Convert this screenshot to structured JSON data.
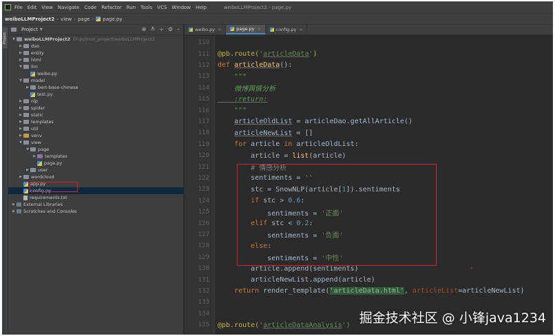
{
  "menubar": {
    "items": [
      "File",
      "Edit",
      "View",
      "Navigate",
      "Code",
      "Refactor",
      "Run",
      "Tools",
      "VCS",
      "Window",
      "Help"
    ],
    "window_title": "weiboLLMProject2 - page.py"
  },
  "navbar": {
    "project": "weiboLLMProject2",
    "crumbs": [
      "view",
      "page",
      "page.py"
    ]
  },
  "project_panel": {
    "strip_label": "Project",
    "title": "Project",
    "tree": [
      {
        "label": "weiboLLMProject2",
        "path": "D:\\python_project\\weiboLLMProject2",
        "indent": 0,
        "arrow": "▼",
        "icon": "folder"
      },
      {
        "label": "dao",
        "indent": 1,
        "arrow": "▶",
        "icon": "folder"
      },
      {
        "label": "entity",
        "indent": 1,
        "arrow": "▶",
        "icon": "folder"
      },
      {
        "label": "html",
        "indent": 1,
        "arrow": "▶",
        "icon": "folder"
      },
      {
        "label": "llm",
        "indent": 1,
        "arrow": "▼",
        "icon": "folder"
      },
      {
        "label": "weibo.py",
        "indent": 2,
        "arrow": "",
        "icon": "py"
      },
      {
        "label": "model",
        "indent": 1,
        "arrow": "▼",
        "icon": "folder"
      },
      {
        "label": "bert-base-chinese",
        "indent": 2,
        "arrow": "▶",
        "icon": "folder"
      },
      {
        "label": "test.py",
        "indent": 2,
        "arrow": "",
        "icon": "py"
      },
      {
        "label": "nlp",
        "indent": 1,
        "arrow": "▶",
        "icon": "folder"
      },
      {
        "label": "spider",
        "indent": 1,
        "arrow": "▶",
        "icon": "folder"
      },
      {
        "label": "static",
        "indent": 1,
        "arrow": "▶",
        "icon": "folder"
      },
      {
        "label": "templates",
        "indent": 1,
        "arrow": "▶",
        "icon": "folder"
      },
      {
        "label": "util",
        "indent": 1,
        "arrow": "▶",
        "icon": "folder"
      },
      {
        "label": "venv",
        "indent": 1,
        "arrow": "▶",
        "icon": "venv"
      },
      {
        "label": "view",
        "indent": 1,
        "arrow": "▼",
        "icon": "folder"
      },
      {
        "label": "page",
        "indent": 2,
        "arrow": "▼",
        "icon": "folder"
      },
      {
        "label": "templates",
        "indent": 3,
        "arrow": "▶",
        "icon": "tpl"
      },
      {
        "label": "page.py",
        "indent": 3,
        "arrow": "",
        "icon": "py"
      },
      {
        "label": "user",
        "indent": 2,
        "arrow": "▶",
        "icon": "folder"
      },
      {
        "label": "wordcloud",
        "indent": 1,
        "arrow": "▶",
        "icon": "folder"
      },
      {
        "label": "app.py",
        "indent": 1,
        "arrow": "",
        "icon": "py"
      },
      {
        "label": "config.py",
        "indent": 1,
        "arrow": "",
        "icon": "py",
        "selected": true
      },
      {
        "label": "requirements.txt",
        "indent": 1,
        "arrow": "",
        "icon": "txt"
      },
      {
        "label": "External Libraries",
        "indent": 0,
        "arrow": "▶",
        "icon": "lib"
      },
      {
        "label": "Scratches and Consoles",
        "indent": 0,
        "arrow": "▶",
        "icon": "lib"
      }
    ]
  },
  "tabs": [
    {
      "label": "weibo.py",
      "active": false
    },
    {
      "label": "page.py",
      "active": true
    },
    {
      "label": "config.py",
      "active": false
    }
  ],
  "code_lines": [
    {
      "no": "110",
      "tokens": []
    },
    {
      "no": "111",
      "tokens": [
        {
          "t": "@pb.route(",
          "c": "dec"
        },
        {
          "t": "'",
          "c": "str"
        },
        {
          "t": "articleData",
          "c": "str ul"
        },
        {
          "t": "'",
          "c": "str"
        },
        {
          "t": ")",
          "c": "dec"
        }
      ]
    },
    {
      "no": "112",
      "tokens": [
        {
          "t": "def ",
          "c": "kw"
        },
        {
          "t": "articleData",
          "c": "fn ul"
        },
        {
          "t": "():",
          "c": "plain"
        }
      ]
    },
    {
      "no": "113",
      "tokens": [
        {
          "t": "    \"\"\"",
          "c": "doc"
        }
      ]
    },
    {
      "no": "114",
      "tokens": [
        {
          "t": "    微博舆情分析",
          "c": "doc"
        }
      ]
    },
    {
      "no": "115",
      "tokens": [
        {
          "t": "    :return:",
          "c": "doc ul"
        }
      ]
    },
    {
      "no": "116",
      "tokens": [
        {
          "t": "    \"\"\"",
          "c": "doc"
        }
      ]
    },
    {
      "no": "117",
      "tokens": [
        {
          "t": "    ",
          "c": "plain"
        },
        {
          "t": "articleOldList",
          "c": "plain ul"
        },
        {
          "t": " = articleDao.getAllArticle()",
          "c": "plain"
        }
      ]
    },
    {
      "no": "118",
      "tokens": [
        {
          "t": "    ",
          "c": "plain"
        },
        {
          "t": "articleNewList",
          "c": "plain ul"
        },
        {
          "t": " = []",
          "c": "plain"
        }
      ]
    },
    {
      "no": "119",
      "tokens": [
        {
          "t": "    for ",
          "c": "kw"
        },
        {
          "t": "article ",
          "c": "plain"
        },
        {
          "t": "in ",
          "c": "kw"
        },
        {
          "t": "articleOldList:",
          "c": "plain"
        }
      ]
    },
    {
      "no": "120",
      "tokens": [
        {
          "t": "        article = ",
          "c": "plain"
        },
        {
          "t": "list",
          "c": "fn"
        },
        {
          "t": "(article)",
          "c": "plain"
        }
      ]
    },
    {
      "no": "121",
      "tokens": [
        {
          "t": "        # 情感分析",
          "c": "cmt"
        }
      ]
    },
    {
      "no": "122",
      "tokens": [
        {
          "t": "        sentiments = ",
          "c": "plain"
        },
        {
          "t": "''",
          "c": "str"
        }
      ]
    },
    {
      "no": "123",
      "tokens": [
        {
          "t": "        stc = SnowNLP(article[",
          "c": "plain"
        },
        {
          "t": "1",
          "c": "num"
        },
        {
          "t": "]).sentiments",
          "c": "plain"
        }
      ]
    },
    {
      "no": "124",
      "tokens": [
        {
          "t": "        if ",
          "c": "kw"
        },
        {
          "t": "stc > ",
          "c": "plain"
        },
        {
          "t": "0.6",
          "c": "num"
        },
        {
          "t": ":",
          "c": "plain"
        }
      ]
    },
    {
      "no": "125",
      "tokens": [
        {
          "t": "            sentiments = ",
          "c": "plain"
        },
        {
          "t": "'正面'",
          "c": "str"
        }
      ]
    },
    {
      "no": "126",
      "tokens": [
        {
          "t": "        elif ",
          "c": "kw"
        },
        {
          "t": "stc < ",
          "c": "plain"
        },
        {
          "t": "0.2",
          "c": "num"
        },
        {
          "t": ":",
          "c": "plain"
        }
      ]
    },
    {
      "no": "127",
      "tokens": [
        {
          "t": "            sentiments = ",
          "c": "plain"
        },
        {
          "t": "'负面'",
          "c": "str"
        }
      ]
    },
    {
      "no": "128",
      "tokens": [
        {
          "t": "        else",
          "c": "kw"
        },
        {
          "t": ":",
          "c": "plain"
        }
      ]
    },
    {
      "no": "129",
      "tokens": [
        {
          "t": "            sentiments = ",
          "c": "plain"
        },
        {
          "t": "'中性'",
          "c": "str"
        }
      ]
    },
    {
      "no": "130",
      "tokens": [
        {
          "t": "        article.append(sentiments)",
          "c": "plain"
        }
      ]
    },
    {
      "no": "131",
      "tokens": [
        {
          "t": "        articleNewList.append(article)",
          "c": "plain"
        }
      ]
    },
    {
      "no": "132",
      "tokens": [
        {
          "t": "    return ",
          "c": "kw"
        },
        {
          "t": "render_template(",
          "c": "plain"
        },
        {
          "t": "'articleData.html'",
          "c": "hl-str"
        },
        {
          "t": ", ",
          "c": "plain"
        },
        {
          "t": "articleList",
          "c": "param"
        },
        {
          "t": "=articleNewList)",
          "c": "plain"
        }
      ]
    },
    {
      "no": "133",
      "tokens": []
    },
    {
      "no": "134",
      "tokens": []
    },
    {
      "no": "135",
      "tokens": [
        {
          "t": "@pb.route(",
          "c": "dec"
        },
        {
          "t": "'",
          "c": "str"
        },
        {
          "t": "articleDataAnalysis",
          "c": "str ul"
        },
        {
          "t": "')",
          "c": "str"
        }
      ]
    }
  ],
  "watermark": "掘金技术社区 @ 小锋java1234",
  "colors": {
    "annotation_red": "#d8232a",
    "editor_bg": "#2b2b2b",
    "panel_bg": "#3c3f41"
  }
}
